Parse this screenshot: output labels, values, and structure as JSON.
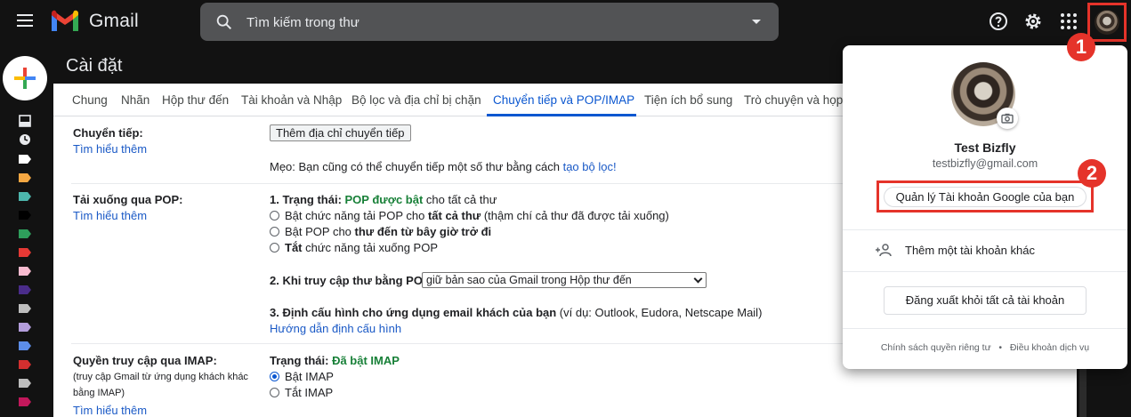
{
  "app": {
    "name": "Gmail"
  },
  "search": {
    "placeholder": "Tìm kiếm trong thư"
  },
  "page": {
    "title": "Cài đặt"
  },
  "tabs": [
    {
      "label": "Chung"
    },
    {
      "label": "Nhãn"
    },
    {
      "label": "Hộp thư đến"
    },
    {
      "label": "Tài khoản và Nhập"
    },
    {
      "label": "Bộ lọc và địa chỉ bị chặn"
    },
    {
      "label": "Chuyển tiếp và POP/IMAP",
      "active": true
    },
    {
      "label": "Tiện ích bổ sung"
    },
    {
      "label": "Trò chuyện và họp"
    }
  ],
  "forwarding": {
    "label": "Chuyển tiếp:",
    "learn_more": "Tìm hiểu thêm",
    "add_button": "Thêm địa chỉ chuyển tiếp",
    "tip_text": "Mẹo: Bạn cũng có thể chuyển tiếp một số thư bằng cách ",
    "tip_link": "tạo bộ lọc!"
  },
  "pop": {
    "label": "Tải xuống qua POP:",
    "learn_more": "Tìm hiểu thêm",
    "status_prefix": "1. Trạng thái: ",
    "status_value": "POP được bật",
    "status_suffix": " cho tất cả thư",
    "options": [
      {
        "pre": "Bật chức năng tải POP cho ",
        "bold": "tất cả thư",
        "post": " (thậm chí cả thư đã được tải xuống)"
      },
      {
        "pre": "Bật POP cho ",
        "bold": "thư đến từ bây giờ trở đi",
        "post": ""
      },
      {
        "pre": "",
        "bold": "Tắt",
        "post": " chức năng tải xuống POP"
      }
    ],
    "access_label": "2. Khi truy cập thư bằng POP",
    "access_select": "giữ bản sao của Gmail trong Hộp thư đến",
    "config_label": "3. Định cấu hình cho ứng dụng email khách của bạn",
    "config_examples": " (ví dụ: Outlook, Eudora, Netscape Mail)",
    "config_link": "Hướng dẫn định cấu hình"
  },
  "imap": {
    "label": "Quyền truy cập qua IMAP:",
    "sublabel_line1": "(truy cập Gmail từ ứng dụng khách khác",
    "sublabel_line2": "bằng IMAP)",
    "learn_more": "Tìm hiểu thêm",
    "status_prefix": "Trạng thái: ",
    "status_value": "Đã bật IMAP",
    "options": [
      "Bật IMAP",
      "Tắt IMAP"
    ],
    "selected": 0
  },
  "account_popup": {
    "name": "Test Bizfly",
    "email": "testbizfly@gmail.com",
    "manage_button": "Quản lý Tài khoản Google của bạn",
    "add_account": "Thêm một tài khoản khác",
    "sign_out": "Đăng xuất khỏi tất cả tài khoản",
    "privacy": "Chính sách quyền riêng tư",
    "separator": "•",
    "terms": "Điều khoản dịch vụ"
  },
  "annotations": {
    "step1": "1",
    "step2": "2",
    "highlight_color": "#e5332a"
  },
  "label_colors": [
    "#ffffff",
    "#f4a742",
    "#4db6ac",
    "#000000",
    "#2e9e5b",
    "#e53935",
    "#f8bbd0",
    "#4a2c8a",
    "#bdbdbd",
    "#b39ddb",
    "#5c8de8",
    "#d32f2f",
    "#bdbdbd",
    "#c2185b"
  ]
}
